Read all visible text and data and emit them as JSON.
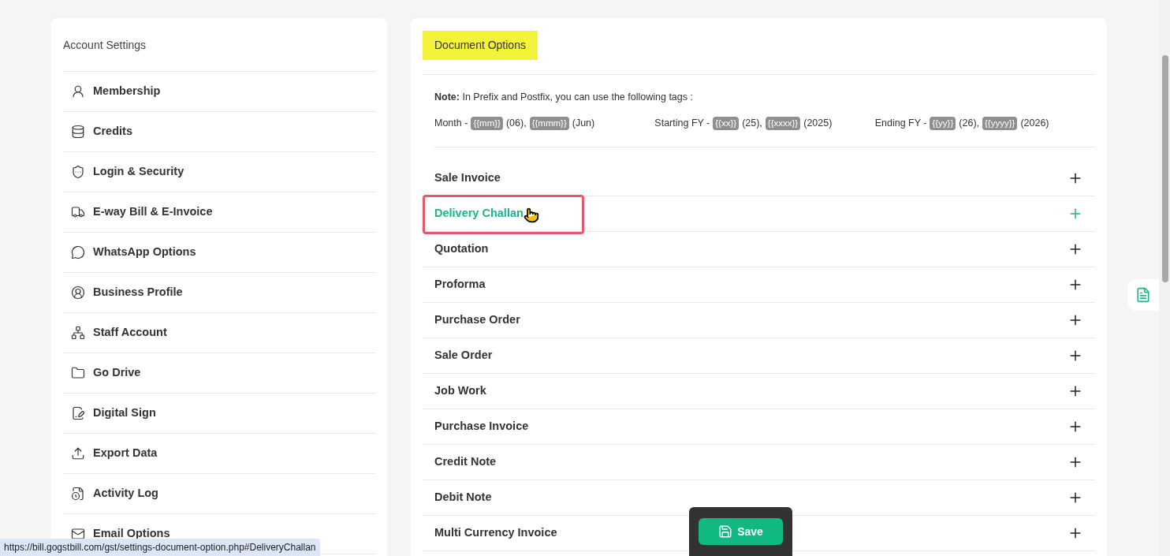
{
  "sidebar": {
    "title": "Account Settings",
    "items": [
      {
        "label": "Membership"
      },
      {
        "label": "Credits"
      },
      {
        "label": "Login & Security"
      },
      {
        "label": "E-way Bill & E-Invoice"
      },
      {
        "label": "WhatsApp Options"
      },
      {
        "label": "Business Profile"
      },
      {
        "label": "Staff Account"
      },
      {
        "label": "Go Drive"
      },
      {
        "label": "Digital Sign"
      },
      {
        "label": "Export Data"
      },
      {
        "label": "Activity Log"
      },
      {
        "label": "Email Options"
      }
    ]
  },
  "main": {
    "title": "Document Options",
    "title_highlighted": true,
    "note": "**Note:** In Prefix and Postfix, you can use the following tags :",
    "tag_groups": [
      {
        "label": "Month -",
        "tags": [
          {
            "tag": "{{mm}}",
            "example": "(06),"
          },
          {
            "tag": "{{mmm}}",
            "example": "(Jun)"
          }
        ]
      },
      {
        "label": "Starting FY -",
        "tags": [
          {
            "tag": "{{xx}}",
            "example": "(25),"
          },
          {
            "tag": "{{xxxx}}",
            "example": "(2025)"
          }
        ]
      },
      {
        "label": "Ending FY -",
        "tags": [
          {
            "tag": "{{yy}}",
            "example": "(26),"
          },
          {
            "tag": "{{yyyy}}",
            "example": "(2026)"
          }
        ]
      }
    ],
    "sections": [
      {
        "label": "Sale Invoice",
        "highlighted": false
      },
      {
        "label": "Delivery Challan",
        "highlighted": true
      },
      {
        "label": "Quotation",
        "highlighted": false
      },
      {
        "label": "Proforma",
        "highlighted": false
      },
      {
        "label": "Purchase Order",
        "highlighted": false
      },
      {
        "label": "Sale Order",
        "highlighted": false
      },
      {
        "label": "Job Work",
        "highlighted": false
      },
      {
        "label": "Purchase Invoice",
        "highlighted": false
      },
      {
        "label": "Credit Note",
        "highlighted": false
      },
      {
        "label": "Debit Note",
        "highlighted": false
      },
      {
        "label": "Multi Currency Invoice",
        "highlighted": false
      }
    ]
  },
  "save_button": "Save",
  "status_url": "https://bill.gogstbill.com/gst/settings-document-option.php#DeliveryChallan"
}
